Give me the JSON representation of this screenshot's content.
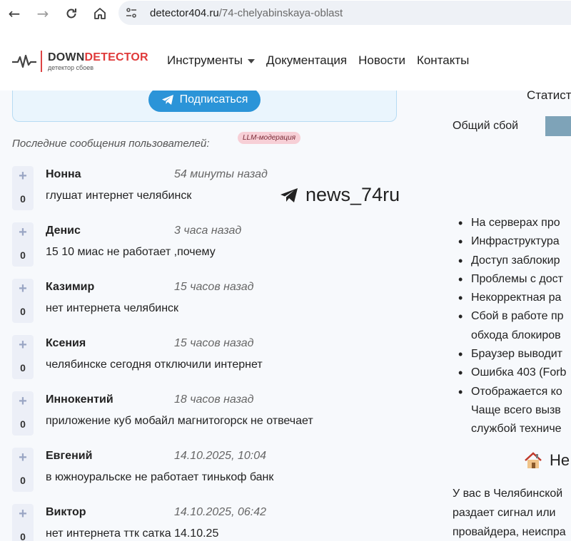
{
  "browser": {
    "url_host": "detector404.ru",
    "url_path": "/74-chelyabinskaya-oblast"
  },
  "header": {
    "logo_brand_a": "DOWN",
    "logo_brand_b": "DETECTOR",
    "logo_tagline": "детектор сбоев",
    "nav": [
      "Инструменты",
      "Документация",
      "Новости",
      "Контакты"
    ]
  },
  "subscribe": {
    "button_label": "Подписаться"
  },
  "messages_section": {
    "title": "Последние сообщения пользователей:",
    "badge": "LLM-модерация"
  },
  "messages": [
    {
      "name": "Нонна",
      "time": "54 минуты назад",
      "text": "глушат интернет челябинск",
      "votes": "0"
    },
    {
      "name": "Денис",
      "time": "3 часа назад",
      "text": "15 10 миас не работает ,почему",
      "votes": "0"
    },
    {
      "name": "Казимир",
      "time": "15 часов назад",
      "text": "нет интернета челябинск",
      "votes": "0"
    },
    {
      "name": "Ксения",
      "time": "15 часов назад",
      "text": "челябинске сегодня отключили интернет",
      "votes": "0"
    },
    {
      "name": "Иннокентий",
      "time": "18 часов назад",
      "text": "приложение куб мобайл магнитогорск не отвечает",
      "votes": "0"
    },
    {
      "name": "Евгений",
      "time": "14.10.2025, 10:04",
      "text": "в южноуральске не работает тинькоф банк",
      "votes": "0"
    },
    {
      "name": "Виктор",
      "time": "14.10.2025, 06:42",
      "text": "нет интернета ттк сатка 14.10.25",
      "votes": "0"
    }
  ],
  "watermark": {
    "text": "news_74ru"
  },
  "right": {
    "stat_title": "Статист",
    "outage_label": "Общий сбой",
    "reasons": [
      "На серверах про",
      "Инфраструктура",
      "Доступ заблокир",
      "Проблемы с дост",
      "Некорректная ра",
      "Сбой в работе пр",
      "обхода блокиров",
      "Браузер выводит",
      "Ошибка 403 (Forb",
      "Отображается ко",
      "Чаще всего вызв",
      "службой техниче"
    ],
    "heading": "Не",
    "para": [
      "У вас в Челябинской",
      "раздает сигнал или",
      "провайдера, неиспра"
    ]
  },
  "colors": {
    "accent": "#2b94d8",
    "brand_red": "#e03a3a",
    "badge_bg": "#f7cfd6"
  }
}
